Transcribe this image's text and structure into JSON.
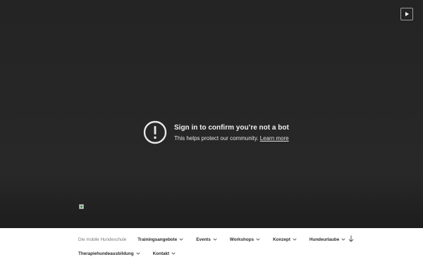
{
  "video": {
    "play_icon": "play-icon",
    "notice": {
      "icon": "exclamation-circle-icon",
      "title": "Sign in to confirm you’re not a bot",
      "message": "This helps protect our community.",
      "link_label": "Learn more"
    },
    "image_icon": "broken-image-icon"
  },
  "nav": {
    "brand": "Die mobile Hundeschule",
    "items": [
      {
        "label": "Trainingsangebote"
      },
      {
        "label": "Events"
      },
      {
        "label": "Workshops"
      },
      {
        "label": "Konzept"
      },
      {
        "label": "Hundeurlaube"
      }
    ],
    "row2": [
      {
        "label": "Therapiehundeausbildung"
      },
      {
        "label": "Kontakt"
      }
    ],
    "scroll_icon": "arrow-down-icon"
  }
}
